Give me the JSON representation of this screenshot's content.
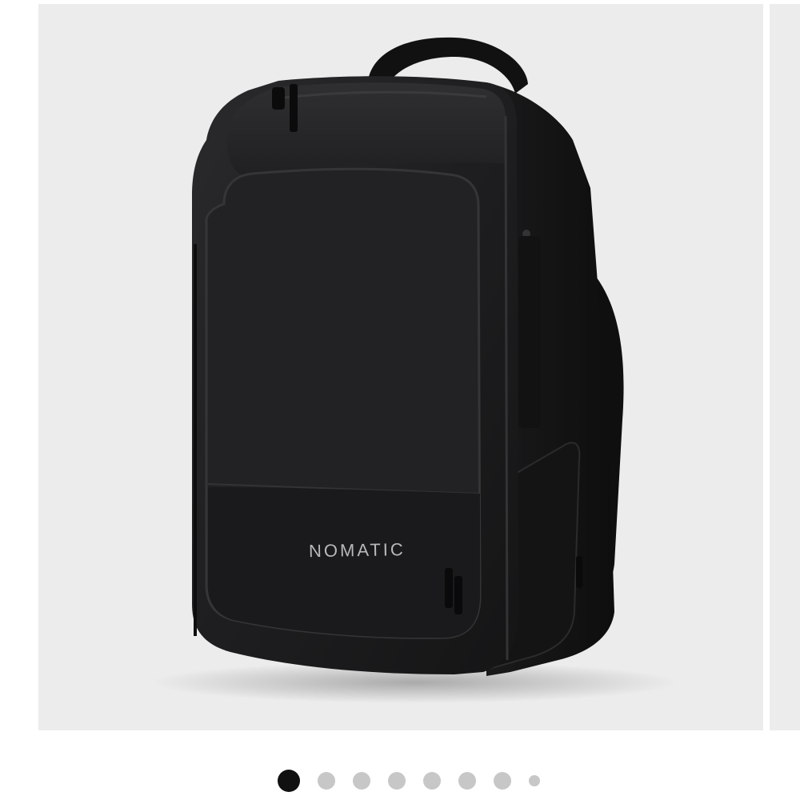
{
  "product": {
    "image_name": "backpack-product-photo",
    "brand_logo_text": "NOMATIC"
  },
  "pager": {
    "total": 8,
    "active_index": 0
  },
  "colors": {
    "background": "#ffffff",
    "slide_background": "#ececec",
    "dot_active": "#111111",
    "dot_inactive": "#c7c7c7",
    "bag_body": "#1b1b1d"
  }
}
